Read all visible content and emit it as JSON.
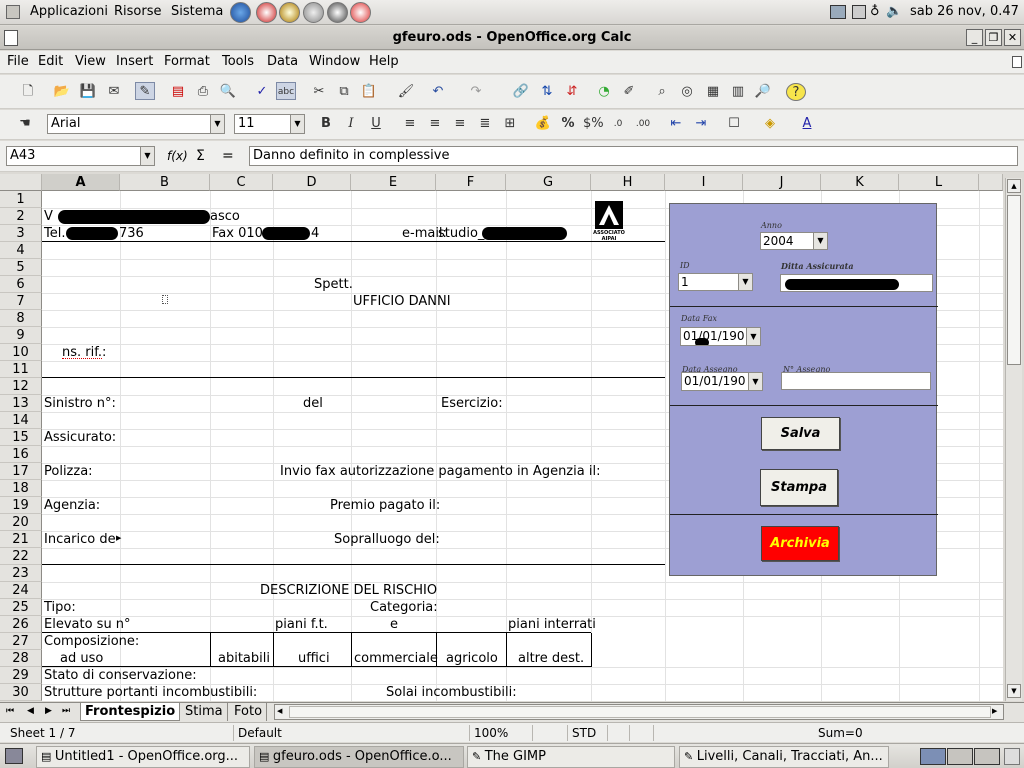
{
  "gnome_panel": {
    "applications": "Applicazioni",
    "places": "Risorse",
    "system": "Sistema",
    "clock": "sab 26 nov,  0.47"
  },
  "window": {
    "title": "gfeuro.ods - OpenOffice.org Calc",
    "minimize": "_",
    "restore": "❐",
    "close": "✕"
  },
  "menu": [
    "File",
    "Edit",
    "View",
    "Insert",
    "Format",
    "Tools",
    "Data",
    "Window",
    "Help"
  ],
  "formatting": {
    "font_name": "Arial",
    "font_size": "11",
    "bold": "B",
    "italic": "I",
    "underline": "U",
    "percent": "%"
  },
  "formula_bar": {
    "cell_ref": "A43",
    "fx": "f(x)",
    "sigma": "Σ",
    "equals": "=",
    "content": "Danno definito in complessive"
  },
  "columns": [
    "A",
    "B",
    "C",
    "D",
    "E",
    "F",
    "G",
    "H",
    "I",
    "J",
    "K",
    "L"
  ],
  "rows": [
    "1",
    "2",
    "3",
    "4",
    "5",
    "6",
    "7",
    "8",
    "9",
    "10",
    "11",
    "12",
    "13",
    "14",
    "15",
    "16",
    "17",
    "18",
    "19",
    "20",
    "21",
    "22",
    "23",
    "24",
    "25",
    "26",
    "27",
    "28",
    "29",
    "30"
  ],
  "cells": {
    "r2_a": "V",
    "r2_b": "asco",
    "r3_a": "Tel. ",
    "r3_a2": "736",
    "r3_c": "Fax 010 ",
    "r3_d": "4",
    "r3_e": "e-mail:",
    "r3_f": "studio_",
    "r6_d": "Spett.",
    "r7_e": "UFFICIO DANNI",
    "r10_a": "ns. rif.:",
    "r13_a": "Sinistro n°:",
    "r13_d": "del",
    "r13_f": "Esercizio:",
    "r15_a": "Assicurato:",
    "r17_a": "Polizza:",
    "r17_d": "Invio fax autorizzazione pagamento in Agenzia il:",
    "r19_a": "Agenzia:",
    "r19_d": "Premio pagato il:",
    "r21_a": "Incarico del",
    "r21_d": "Sopralluogo del:",
    "r24_d": "DESCRIZIONE DEL RISCHIO",
    "r25_a": "Tipo:",
    "r25_e": "Categoria:",
    "r26_a": "Elevato su n°",
    "r26_d": "piani f.t.",
    "r26_e": "e",
    "r26_g": "piani interrati",
    "r27_a": "Composizione:",
    "r28_a": "ad uso",
    "r28_c": "abitabili",
    "r28_d": "uffici",
    "r28_e": "commerciale",
    "r28_f": "agricolo",
    "r28_g": "altre dest.",
    "r29_a": "Stato di conservazione:",
    "r30_a": "Strutture portanti incombustibili:",
    "r30_e": "Solai incombustibili:",
    "logo_caption": "ASSOCIATO AIPAI"
  },
  "form": {
    "anno_label": "Anno",
    "anno_value": "2004",
    "id_label": "ID",
    "id_value": "1",
    "ditta_label": "Ditta Assicurata",
    "data_fax_label": "Data Fax",
    "data_fax_value": "01/01/190",
    "data_assegno_label": "Data Assegno",
    "data_assegno_value": "01/01/190",
    "n_assegno_label": "N° Assegno",
    "salva": "Salva",
    "stampa": "Stampa",
    "archivia": "Archivia"
  },
  "sheet_tabs": [
    "Frontespizio",
    "Stima",
    "Foto"
  ],
  "status": {
    "sheet": "Sheet 1 / 7",
    "style": "Default",
    "zoom": "100%",
    "mode": "STD",
    "sum": "Sum=0"
  },
  "taskbar": [
    "Untitled1 - OpenOffice.org...",
    "gfeuro.ods - OpenOffice.o...",
    "The GIMP",
    "Livelli, Canali, Tracciati, An..."
  ],
  "colors": {
    "form_bg": "#9d9fd3",
    "archivia_bg": "#ff0000",
    "archivia_fg": "#ffff00"
  }
}
